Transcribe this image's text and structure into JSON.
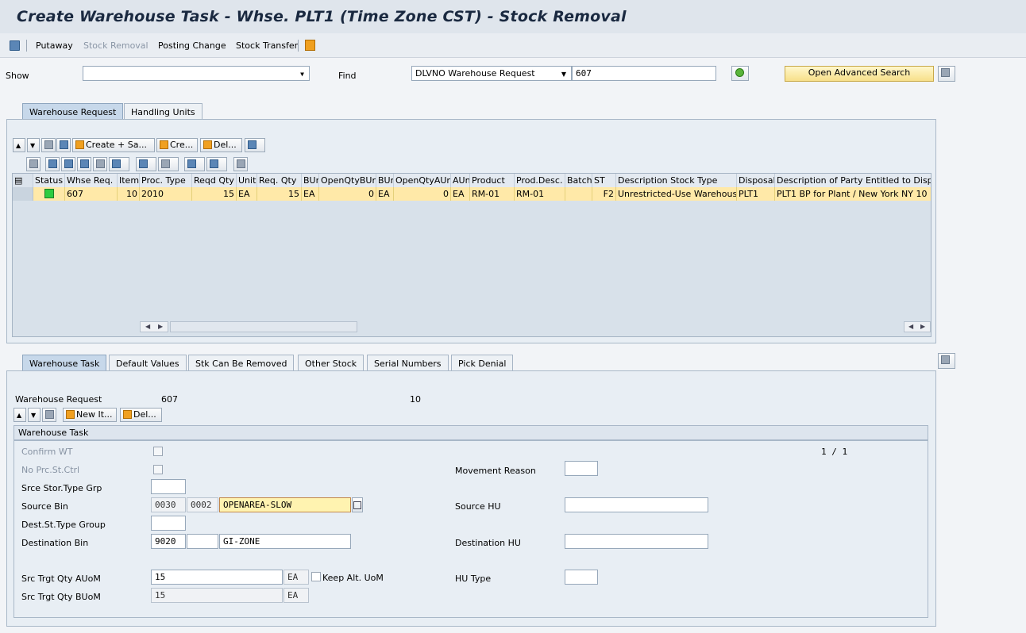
{
  "window": {
    "title": "Create Warehouse Task - Whse. PLT1 (Time Zone CST) - Stock Removal"
  },
  "toolbar": {
    "items": [
      "Putaway",
      "Stock Removal",
      "Posting Change",
      "Stock Transfer"
    ]
  },
  "search": {
    "show_label": "Show",
    "show_value": "",
    "find_label": "Find",
    "find_type": "DLVNO Warehouse Request",
    "find_value": "607",
    "advanced_button": "Open Advanced Search"
  },
  "top_tabs": [
    "Warehouse Request",
    "Handling Units"
  ],
  "grid_toolbar": {
    "create_save": "Create + Sa...",
    "create": "Cre...",
    "delete": "Del..."
  },
  "table": {
    "columns": [
      "Status",
      "Whse Req.",
      "Item",
      "Proc. Type",
      "Reqd Qty",
      "Unit",
      "Req. Qty",
      "BUn",
      "OpenQtyBUn",
      "BUn",
      "OpenQtyAUn",
      "AUn",
      "Product",
      "Prod.Desc.",
      "Batch",
      "ST",
      "Description Stock Type",
      "Disposal",
      "Description of Party Entitled to Dispo"
    ],
    "rows": [
      [
        "",
        "607",
        "10",
        "2010",
        "15",
        "EA",
        "15",
        "EA",
        "0",
        "EA",
        "0",
        "EA",
        "RM-01",
        "RM-01",
        "",
        "F2",
        "Unrestricted-Use Warehouse",
        "PLT1",
        "PLT1 BP for Plant / New York NY 10"
      ]
    ]
  },
  "bottom_tabs": [
    "Warehouse Task",
    "Default Values",
    "Stk Can Be Removed",
    "Other Stock",
    "Serial Numbers",
    "Pick Denial"
  ],
  "task": {
    "whse_req_label": "Warehouse Request",
    "whse_req_value": "607",
    "item_value": "10",
    "new_item": "New It...",
    "delete": "Del...",
    "section_title": "Warehouse Task",
    "page_counter": "1 / 1",
    "confirm_wt": "Confirm WT",
    "no_prc": "No Prc.St.Ctrl",
    "srce_grp": "Srce Stor.Type Grp",
    "source_bin": "Source Bin",
    "source_bin_type": "0030",
    "source_bin_sect": "0002",
    "source_bin_value": "OPENAREA-SLOW",
    "dest_grp": "Dest.St.Type Group",
    "dest_bin": "Destination Bin",
    "dest_bin_type": "9020",
    "dest_bin_value": "GI-ZONE",
    "src_qty_auom": "Src Trgt Qty AUoM",
    "src_qty_auom_value": "15",
    "src_qty_auom_unit": "EA",
    "keep_alt": "Keep Alt. UoM",
    "src_qty_buom": "Src Trgt Qty BUoM",
    "src_qty_buom_value": "15",
    "src_qty_buom_unit": "EA",
    "movement_reason": "Movement Reason",
    "source_hu": "Source HU",
    "dest_hu": "Destination HU",
    "hu_type": "HU Type"
  },
  "colors": {
    "accent": "#c7d8ea",
    "selected_row": "#ffe9a8",
    "status_green": "#2ecc40"
  }
}
